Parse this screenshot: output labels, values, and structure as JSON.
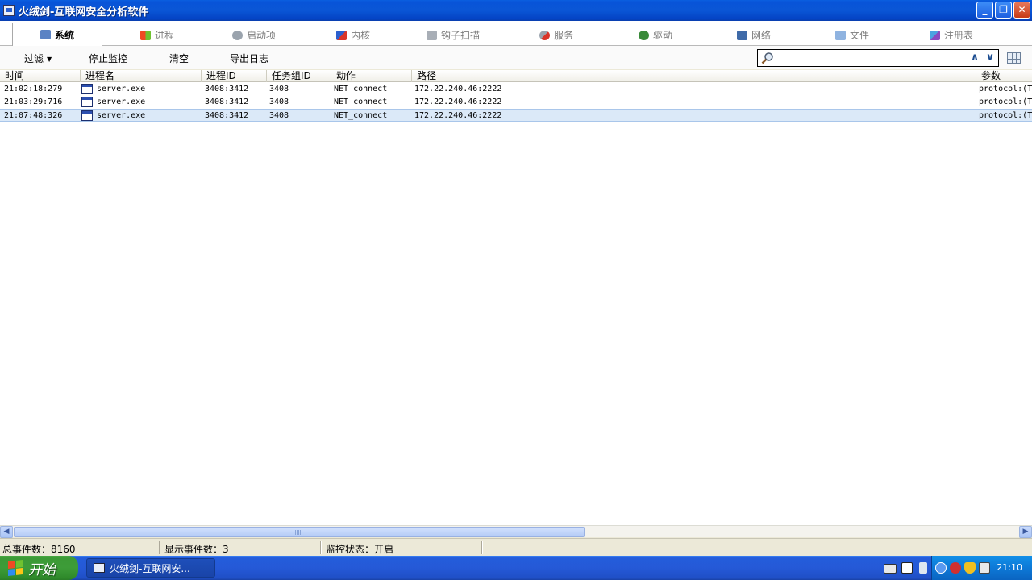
{
  "window": {
    "title": "火绒剑-互联网安全分析软件",
    "buttons": {
      "minimize": "_",
      "restore": "❐",
      "close": "✕"
    }
  },
  "tabs": [
    {
      "label": "系统",
      "icon": "monitor-icon",
      "active": true
    },
    {
      "label": "进程",
      "icon": "windows-flag-icon",
      "active": false
    },
    {
      "label": "启动项",
      "icon": "gear-icon",
      "active": false
    },
    {
      "label": "内核",
      "icon": "kernel-icon",
      "active": false
    },
    {
      "label": "钩子扫描",
      "icon": "hook-icon",
      "active": false
    },
    {
      "label": "服务",
      "icon": "service-icon",
      "active": false
    },
    {
      "label": "驱动",
      "icon": "driver-icon",
      "active": false
    },
    {
      "label": "网络",
      "icon": "network-icon",
      "active": false
    },
    {
      "label": "文件",
      "icon": "file-icon",
      "active": false
    },
    {
      "label": "注册表",
      "icon": "registry-icon",
      "active": false
    }
  ],
  "toolbar": {
    "filter_label": "过滤",
    "filter_arrow": "▼",
    "stop_label": "停止监控",
    "clear_label": "清空",
    "export_label": "导出日志",
    "search_value": "",
    "search_up": "∧",
    "search_down": "∨"
  },
  "table": {
    "columns": [
      "时间",
      "进程名",
      "进程ID",
      "任务组ID",
      "动作",
      "路径",
      "参数"
    ],
    "rows": [
      {
        "time": "21:02:18:279",
        "process": "server.exe",
        "pid": "3408:3412",
        "group": "3408",
        "action": "NET_connect",
        "path": "172.22.240.46:2222",
        "params": "protocol:(T",
        "selected": false
      },
      {
        "time": "21:03:29:716",
        "process": "server.exe",
        "pid": "3408:3412",
        "group": "3408",
        "action": "NET_connect",
        "path": "172.22.240.46:2222",
        "params": "protocol:(T",
        "selected": false
      },
      {
        "time": "21:07:48:326",
        "process": "server.exe",
        "pid": "3408:3412",
        "group": "3408",
        "action": "NET_connect",
        "path": "172.22.240.46:2222",
        "params": "protocol:(T",
        "selected": true
      }
    ]
  },
  "scrollbar": {
    "left": "◀",
    "right": "▶"
  },
  "status": {
    "total": "总事件数：8160",
    "shown": "显示事件数：3",
    "monitor": "监控状态：开启"
  },
  "taskbar": {
    "start_label": "开始",
    "task_label": "火绒剑-互联网安...",
    "clock": "21:10"
  }
}
